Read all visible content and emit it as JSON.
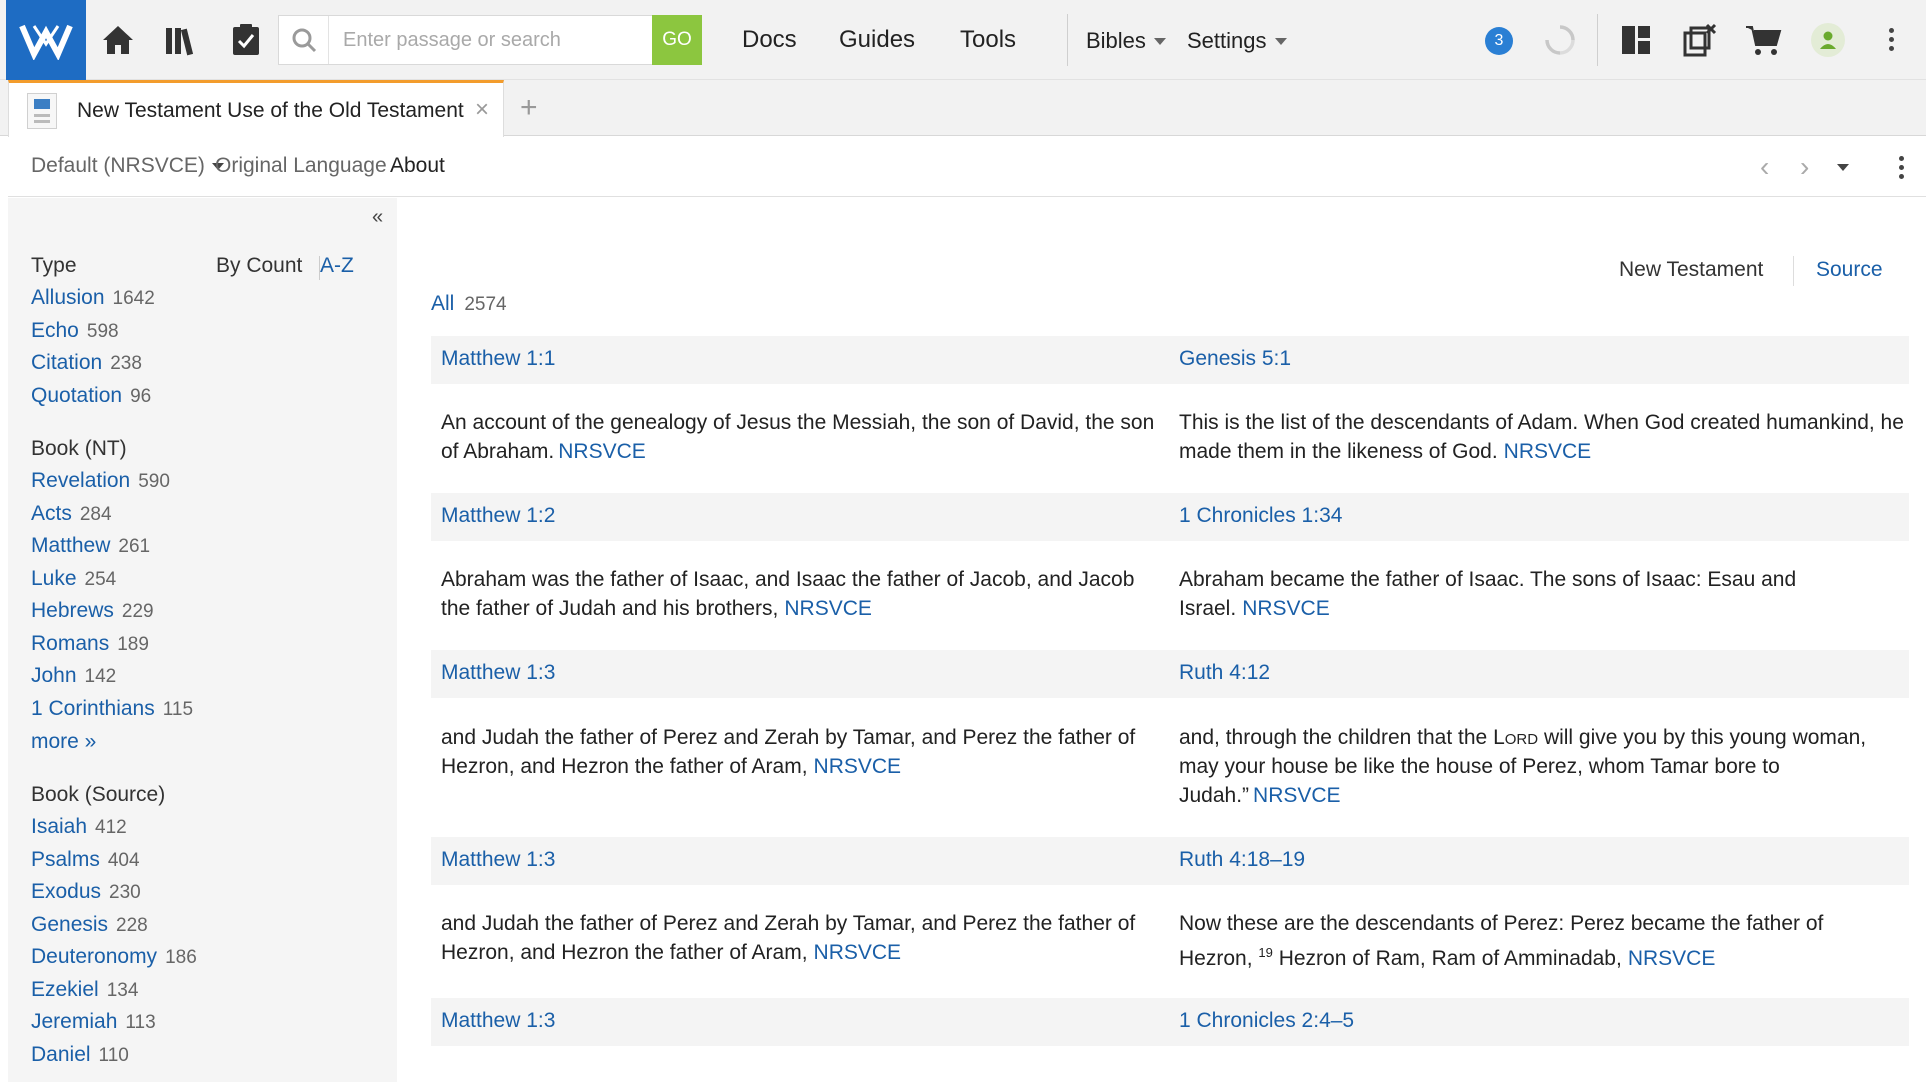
{
  "toolbar": {
    "logo_icon": "logos-w-icon",
    "search_placeholder": "Enter passage or search",
    "go_label": "GO",
    "nav": {
      "docs": "Docs",
      "guides": "Guides",
      "tools": "Tools"
    },
    "bibles_label": "Bibles",
    "settings_label": "Settings",
    "notification_count": "3",
    "accent_color": "#1e6cc3",
    "go_color": "#8cc63f"
  },
  "tab": {
    "title": "New Testament Use of the Old Testament",
    "close": "×",
    "add": "+"
  },
  "subbar": {
    "version": "Default (NRSVCE)",
    "original_language": "Original Language",
    "about": "About"
  },
  "sidebar": {
    "collapse": "«",
    "type_heading": "Type",
    "sort_by_count": "By Count",
    "sort_az": "A-Z",
    "types": [
      {
        "label": "Allusion",
        "count": "1642"
      },
      {
        "label": "Echo",
        "count": "598"
      },
      {
        "label": "Citation",
        "count": "238"
      },
      {
        "label": "Quotation",
        "count": "96"
      }
    ],
    "book_nt_heading": "Book (NT)",
    "books_nt": [
      {
        "label": "Revelation",
        "count": "590"
      },
      {
        "label": "Acts",
        "count": "284"
      },
      {
        "label": "Matthew",
        "count": "261"
      },
      {
        "label": "Luke",
        "count": "254"
      },
      {
        "label": "Hebrews",
        "count": "229"
      },
      {
        "label": "Romans",
        "count": "189"
      },
      {
        "label": "John",
        "count": "142"
      },
      {
        "label": "1 Corinthians",
        "count": "115"
      }
    ],
    "more": "more »",
    "book_source_heading": "Book (Source)",
    "books_source": [
      {
        "label": "Isaiah",
        "count": "412"
      },
      {
        "label": "Psalms",
        "count": "404"
      },
      {
        "label": "Exodus",
        "count": "230"
      },
      {
        "label": "Genesis",
        "count": "228"
      },
      {
        "label": "Deuteronomy",
        "count": "186"
      },
      {
        "label": "Ezekiel",
        "count": "134"
      },
      {
        "label": "Jeremiah",
        "count": "113"
      },
      {
        "label": "Daniel",
        "count": "110"
      }
    ]
  },
  "main": {
    "toggle_nt": "New Testament",
    "toggle_source": "Source",
    "all_label": "All",
    "all_count": "2574",
    "entries": [
      {
        "nt_ref": "Matthew 1:1",
        "ot_ref": "Genesis 5:1",
        "nt_text": "An account of the genealogy of Jesus the Messiah, the son of David, the son of Abraham.",
        "ot_text": "This is the list of the descendants of Adam. When God created humankind, he made them in the likeness of God.",
        "version": "NRSVCE"
      },
      {
        "nt_ref": "Matthew 1:2",
        "ot_ref": "1 Chronicles 1:34",
        "nt_text": "Abraham was the father of Isaac, and Isaac the father of Jacob, and Jacob the father of Judah and his brothers,",
        "ot_text": "Abraham became the father of Isaac. The sons of Isaac: Esau and Israel.",
        "version": "NRSVCE"
      },
      {
        "nt_ref": "Matthew 1:3",
        "ot_ref": "Ruth 4:12",
        "nt_text": "and Judah the father of Perez and Zerah by Tamar, and Perez the father of Hezron, and Hezron the father of Aram,",
        "ot_text_before": "and, through the children that the",
        "ot_lord": "Lord",
        "ot_text_after": "will give you by this young woman, may your house be like the house of Perez, whom Tamar bore to Judah.”",
        "version": "NRSVCE"
      },
      {
        "nt_ref": "Matthew 1:3",
        "ot_ref": "Ruth 4:18–19",
        "nt_text": "and Judah the father of Perez and Zerah by Tamar, and Perez the father of Hezron, and Hezron the father of Aram,",
        "ot_text_before": "Now these are the descendants of Perez: Perez became the father of Hezron,",
        "ot_verse_num": "19",
        "ot_text_after": "Hezron of Ram, Ram of Amminadab,",
        "version": "NRSVCE"
      },
      {
        "nt_ref": "Matthew 1:3",
        "ot_ref": "1 Chronicles 2:4–5"
      }
    ]
  }
}
